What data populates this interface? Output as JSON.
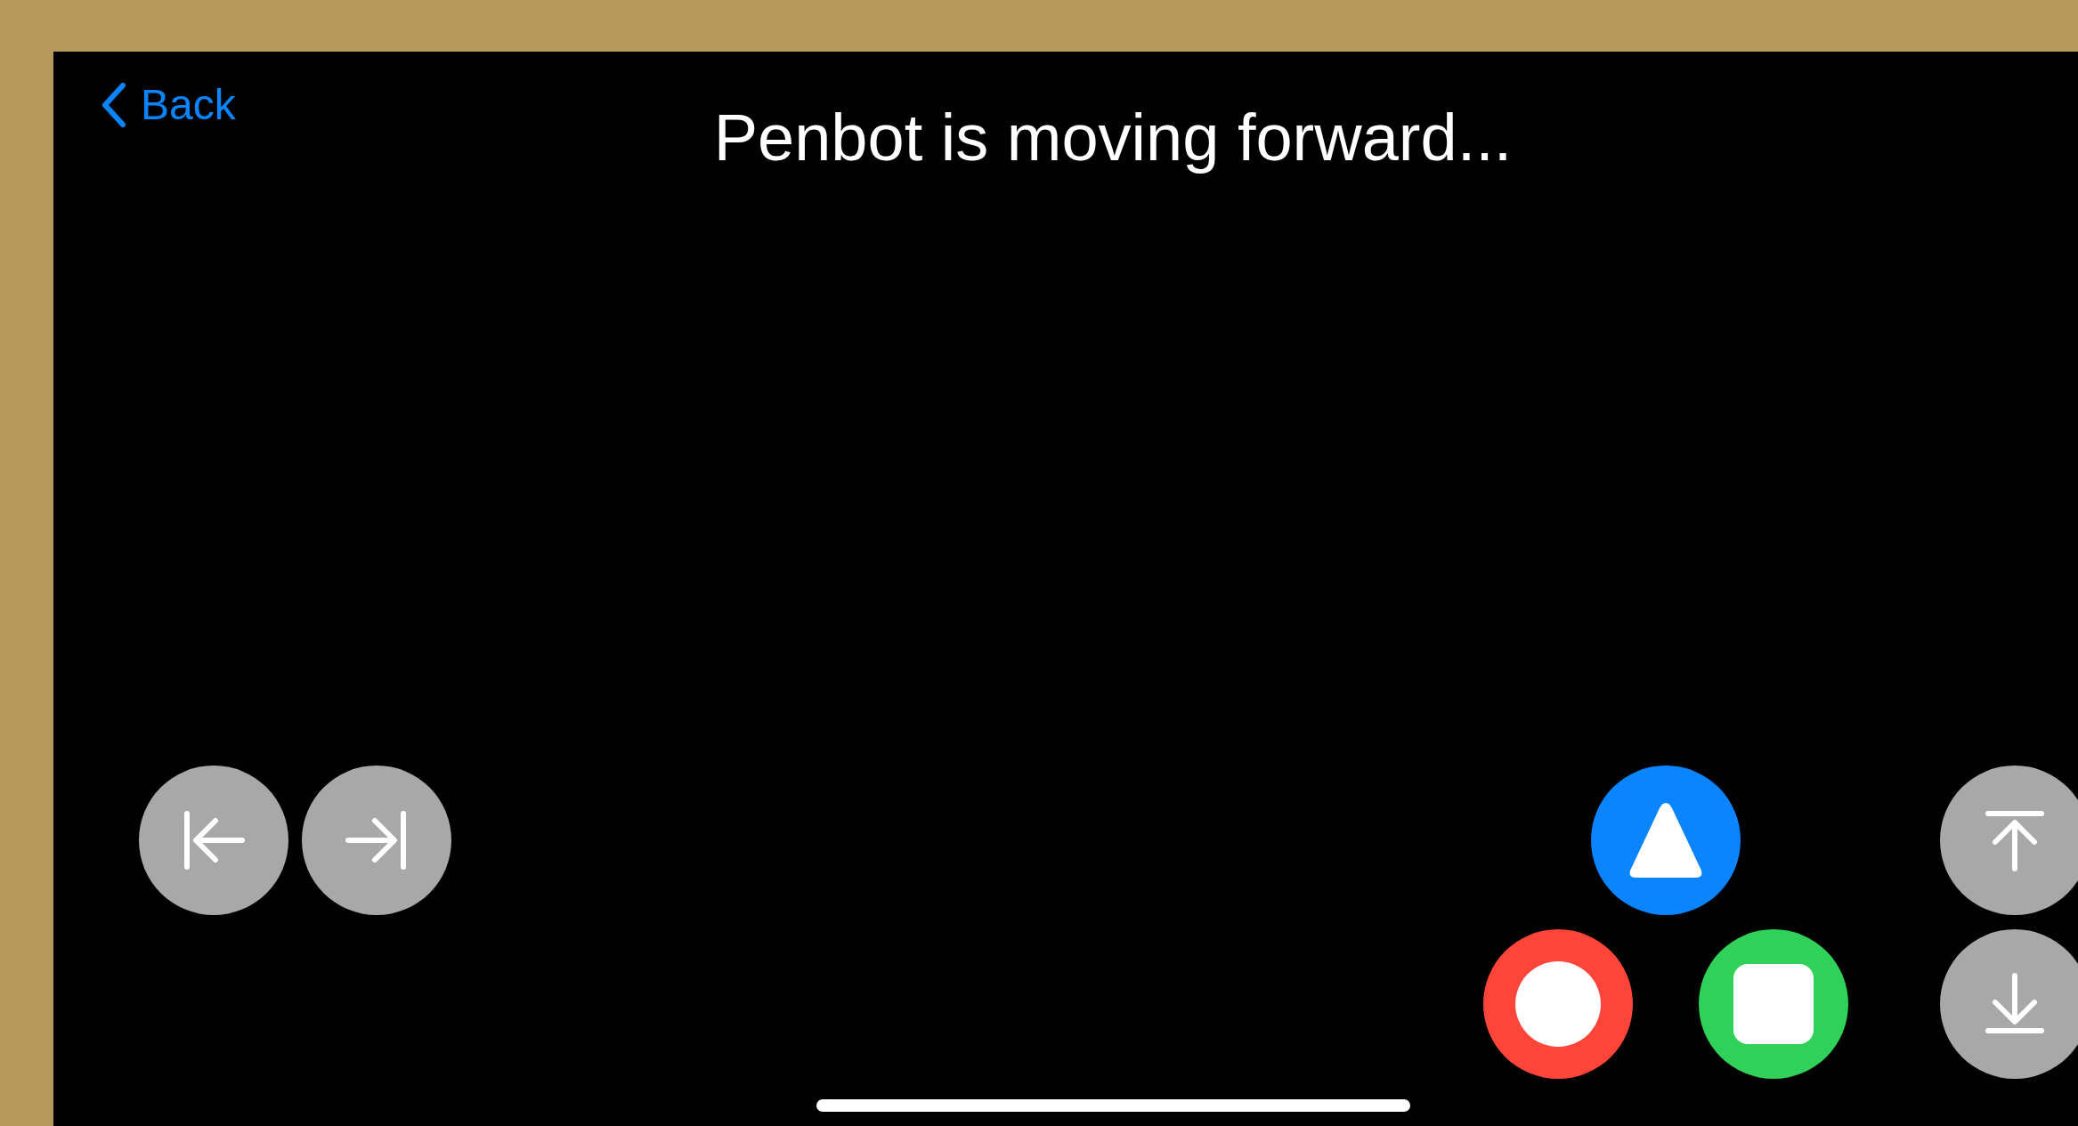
{
  "back": {
    "label": "Back"
  },
  "title": "Penbot is moving forward...",
  "buttons": [
    {
      "kind": "left"
    },
    {
      "kind": "right"
    },
    {
      "kind": "triangle"
    },
    {
      "kind": "circle"
    },
    {
      "kind": "square"
    },
    {
      "kind": "up"
    },
    {
      "kind": "down"
    }
  ]
}
